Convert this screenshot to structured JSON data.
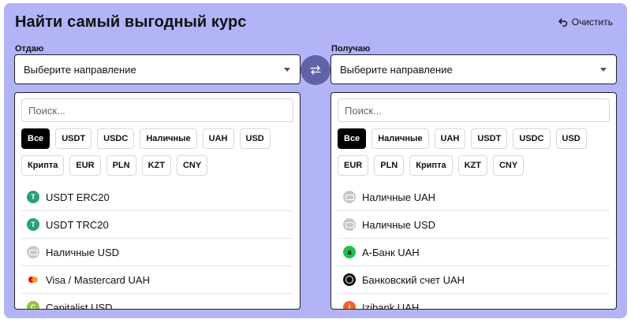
{
  "header": {
    "title": "Найти самый выгодный курс",
    "clear_label": "Очистить"
  },
  "give": {
    "label": "Отдаю",
    "select_value": "Выберите направление",
    "search_placeholder": "Поиск...",
    "filters": [
      "Все",
      "USDT",
      "USDC",
      "Наличные",
      "UAH",
      "USD",
      "Крипта",
      "EUR",
      "PLN",
      "KZT",
      "CNY"
    ],
    "active_filter": "Все",
    "items": [
      {
        "label": "USDT ERC20",
        "icon": "tether-icon"
      },
      {
        "label": "USDT TRC20",
        "icon": "tether-icon"
      },
      {
        "label": "Наличные USD",
        "icon": "cash-icon"
      },
      {
        "label": "Visa / Mastercard UAH",
        "icon": "card-icon"
      },
      {
        "label": "Capitalist USD",
        "icon": "capitalist-icon"
      }
    ]
  },
  "get": {
    "label": "Получаю",
    "select_value": "Выберите направление",
    "search_placeholder": "Поиск...",
    "filters": [
      "Все",
      "Наличные",
      "UAH",
      "USDT",
      "USDC",
      "USD",
      "EUR",
      "PLN",
      "Крипта",
      "KZT",
      "CNY"
    ],
    "active_filter": "Все",
    "items": [
      {
        "label": "Наличные UAH",
        "icon": "cash-icon"
      },
      {
        "label": "Наличные USD",
        "icon": "cash-icon"
      },
      {
        "label": "A-Банк UAH",
        "icon": "abank-icon"
      },
      {
        "label": "Банковский счет UAH",
        "icon": "bank-icon"
      },
      {
        "label": "Izibank UAH",
        "icon": "izibank-icon"
      }
    ]
  },
  "colors": {
    "panel": "#b3b3f8",
    "swap": "#6262a8",
    "tether": "#26a17b",
    "abank": "#1dc14d"
  }
}
